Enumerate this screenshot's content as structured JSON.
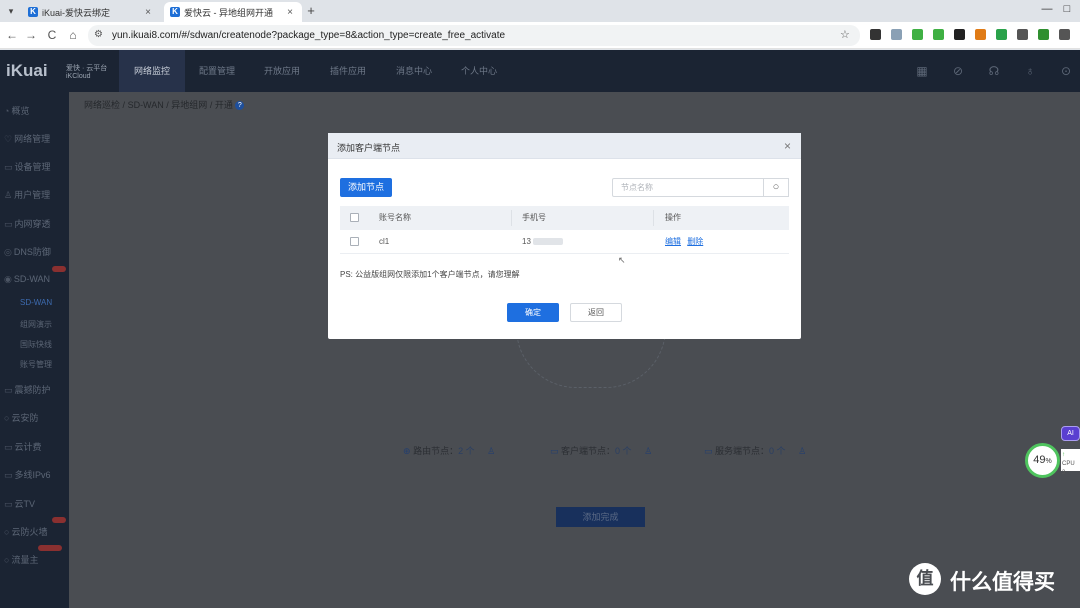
{
  "browser": {
    "tabs": [
      {
        "title": "iKuai-爱快云绑定",
        "close": "×"
      },
      {
        "title": "爱快云 - 异地组网开通",
        "close": "×"
      }
    ],
    "tab_list_icon": "▾",
    "new_tab": "+",
    "window_controls": {
      "minimize": "—",
      "maximize": "□"
    },
    "favicon_letter": "K",
    "url": "yun.ikuai8.com/#/sdwan/createnode?package_type=8&action_type=create_free_activate",
    "nav": {
      "back": "←",
      "forward": "→",
      "reload": "C",
      "home": "⌂"
    },
    "url_icon": "⚙",
    "star": "☆",
    "extension_colors": [
      "#333333",
      "#8aa0b5",
      "#3fb043",
      "#3fb043",
      "#222222",
      "#e07b16",
      "#2aa24a",
      "#555555",
      "#2f8f2f",
      "#555555"
    ]
  },
  "app": {
    "logo": "iKuai",
    "logo_sub1": "爱快 · 云平台",
    "logo_sub2": "iKCloud",
    "top_nav": [
      "网络监控",
      "配置管理",
      "开放应用",
      "插件应用",
      "消息中心",
      "个人中心"
    ],
    "header_icons": [
      "▦",
      "⊘",
      "☊",
      "♁",
      "⊙"
    ]
  },
  "sidebar": {
    "items": [
      {
        "icon": "◔",
        "label": "概览"
      },
      {
        "icon": "♡",
        "label": "网络管理"
      },
      {
        "icon": "▭",
        "label": "设备管理"
      },
      {
        "icon": "♙",
        "label": "用户管理"
      },
      {
        "icon": "▭",
        "label": "内网穿透"
      },
      {
        "icon": "◎",
        "label": "DNS防御"
      },
      {
        "icon": "◉",
        "label": "SD-WAN"
      },
      {
        "icon": "",
        "label": "SD-WAN"
      },
      {
        "icon": "",
        "label": "组网演示"
      },
      {
        "icon": "",
        "label": "国际快线"
      },
      {
        "icon": "",
        "label": "账号管理"
      },
      {
        "icon": "▭",
        "label": "震撼防护"
      },
      {
        "icon": "○",
        "label": "云安防"
      },
      {
        "icon": "▭",
        "label": "云计费"
      },
      {
        "icon": "▭",
        "label": "多线IPv6"
      },
      {
        "icon": "▭",
        "label": "云TV"
      },
      {
        "icon": "○",
        "label": "云防火墙"
      },
      {
        "icon": "○",
        "label": "流量主"
      }
    ]
  },
  "page": {
    "breadcrumb": [
      "网络巡检",
      "SD-WAN",
      "异地组网",
      "开通"
    ],
    "breadcrumb_sep": "/",
    "breadcrumb_info": "?",
    "stats": [
      {
        "icon": "⊕",
        "label": "路由节点：",
        "value": "2 个",
        "user_icon": "♙"
      },
      {
        "icon": "▭",
        "label": "客户端节点：",
        "value": "0 个",
        "user_icon": "♙"
      },
      {
        "icon": "▭",
        "label": "服务端节点：",
        "value": "0 个",
        "user_icon": "♙"
      }
    ],
    "finish_button": "添加完成"
  },
  "modal": {
    "title": "添加客户端节点",
    "close": "×",
    "add_button": "添加节点",
    "search_placeholder": "节点名称",
    "search_icon": "○",
    "columns": [
      "账号名称",
      "手机号",
      "操作"
    ],
    "rows": [
      {
        "name": "cl1",
        "phone": "13",
        "edit": "编辑",
        "delete": "删除"
      }
    ],
    "note": "PS: 公益版组网仅限添加1个客户端节点，请您理解",
    "ok_button": "确定",
    "back_button": "返回"
  },
  "widgets": {
    "ai_badge": "AI",
    "gauge_value": "49",
    "gauge_unit": "%",
    "cpu_arrow": "↑",
    "cpu_label": "CPU 3"
  },
  "watermark": {
    "icon_text": "值",
    "text": "什么值得买"
  }
}
